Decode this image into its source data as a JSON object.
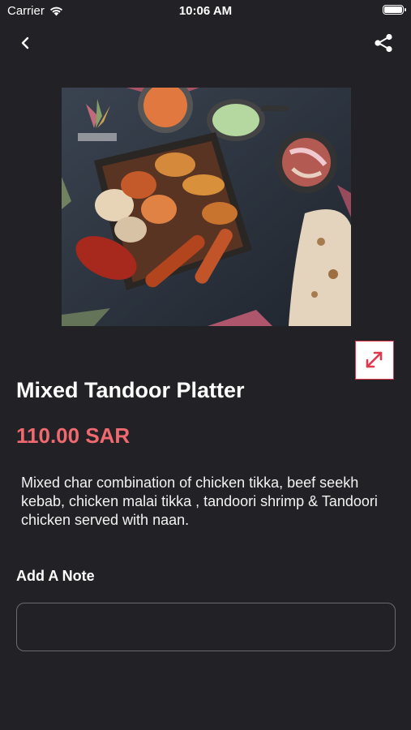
{
  "status_bar": {
    "carrier": "Carrier",
    "time": "10:06 AM"
  },
  "nav": {
    "back_icon": "chevron-left-icon",
    "share_icon": "share-icon"
  },
  "item": {
    "image_alt": "Mixed Tandoor Platter dish photo",
    "title": "Mixed Tandoor Platter",
    "price": "110.00 SAR",
    "description": "Mixed char combination of chicken tikka, beef seekh kebab, chicken malai tikka , tandoori shrimp & Tandoori chicken served with naan."
  },
  "note": {
    "label": "Add A Note",
    "placeholder": "",
    "value": ""
  },
  "colors": {
    "background": "#222226",
    "price": "#f0696e",
    "expand_border": "#e0384d"
  }
}
